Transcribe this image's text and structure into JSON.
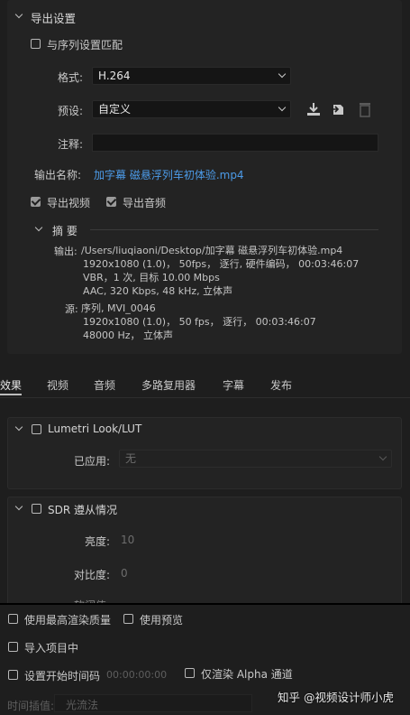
{
  "export_settings": {
    "section_title": "导出设置",
    "match_sequence_label": "与序列设置匹配",
    "format_label": "格式:",
    "format_value": "H.264",
    "preset_label": "预设:",
    "preset_value": "自定义",
    "comment_label": "注释:",
    "comment_value": "",
    "output_name_label": "输出名称:",
    "output_name_value": "加字幕 磁悬浮列车初体验.mp4",
    "export_video_label": "导出视频",
    "export_audio_label": "导出音频",
    "summary_title": "摘 要",
    "output_label": "输出:",
    "output_lines": [
      "/Users/liuqiaoni/Desktop/加字幕 磁悬浮列车初体验.mp4",
      "1920x1080 (1.0)， 50fps， 逐行, 硬件编码， 00:03:46:07",
      "VBR，1 次, 目标 10.00 Mbps",
      "AAC, 320 Kbps, 48  kHz, 立体声"
    ],
    "source_label": "源:",
    "source_lines": [
      "序列, MVI_0046",
      "1920x1080 (1.0)， 50 fps， 逐行， 00:03:46:07",
      "48000 Hz， 立体声"
    ]
  },
  "tabs": [
    "效果",
    "视频",
    "音频",
    "多路复用器",
    "字幕",
    "发布"
  ],
  "effects": {
    "lumetri_title": "Lumetri Look/LUT",
    "applied_label": "已应用:",
    "applied_value": "无",
    "sdr_title": "SDR 遵从情况",
    "brightness_label": "亮度:",
    "brightness_value": "10",
    "contrast_label": "对比度:",
    "contrast_value": "0",
    "partial_label": "软阈值"
  },
  "bottom": {
    "max_render_quality": "使用最高渲染质量",
    "use_previews": "使用预览",
    "import_into_project": "导入项目中",
    "set_start_timecode": "设置开始时间码",
    "start_timecode_value": "00:00:00:00",
    "render_alpha_only": "仅渲染 Alpha 通道",
    "time_interpolation_label": "时间插值:",
    "time_interpolation_value": "光流法"
  },
  "watermark": "知乎 @视频设计师小虎",
  "colors": {
    "background": "#1e1e1e",
    "link": "#4c9be8",
    "text": "#c8c8c8"
  }
}
